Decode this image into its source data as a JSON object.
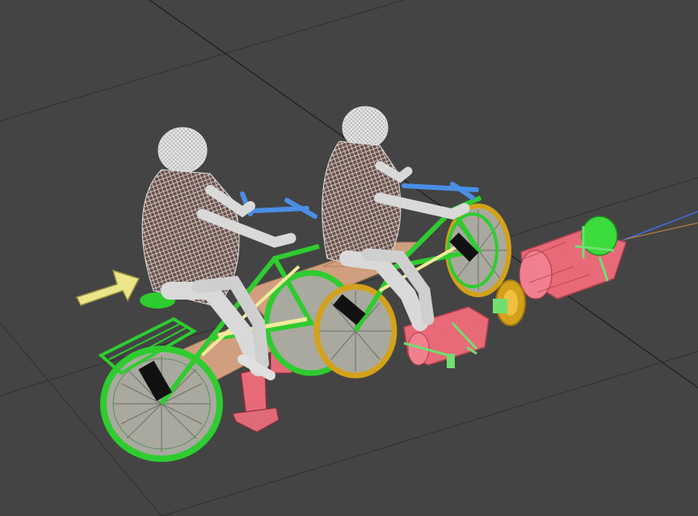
{
  "viewport": {
    "background": "#444444",
    "grid_color": "#2f2f2f",
    "axis_color": "#1c1c1c"
  },
  "scene": {
    "riders": [
      {
        "name": "rear-rider",
        "wire_color": "#d9d9d9",
        "body_color": "#6b5048"
      },
      {
        "name": "front-rider",
        "wire_color": "#d9d9d9",
        "body_color": "#6b5048"
      }
    ],
    "bikes": {
      "wire_color": "#2ecc2e",
      "rim_color": "#d4a21a",
      "spoke_color": "#a9a9a0"
    },
    "handlebars_color": "#4a8ee6",
    "frame_color": "#f0ea9a",
    "plates_color": "#e8b08a",
    "hub_color": "#e07080",
    "arrow_color": "#ece68a",
    "barrel_color": "#e86a78",
    "line_color": "#3f6fe0",
    "line_accent_color": "#d08a3a"
  }
}
